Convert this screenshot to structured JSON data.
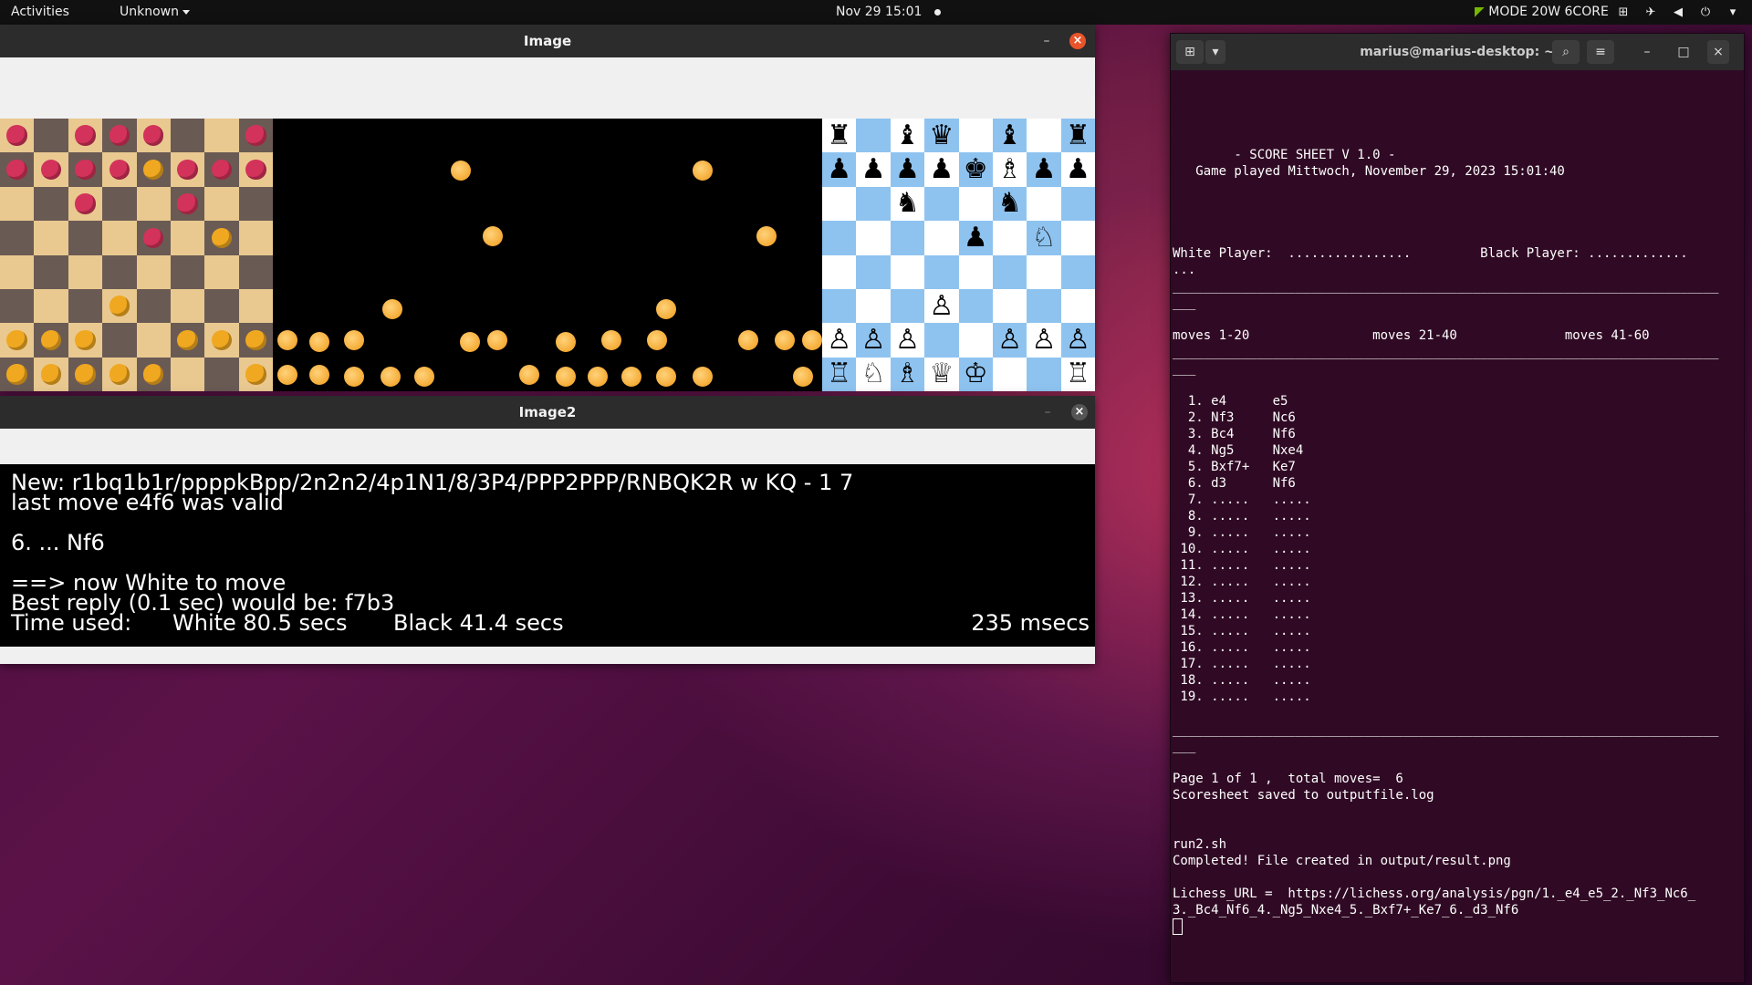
{
  "topbar": {
    "activities": "Activities",
    "app_menu": "Unknown",
    "datetime": "Nov 29  15:01",
    "gpu_mode": "MODE 20W 6CORE"
  },
  "image_window": {
    "title": "Image"
  },
  "image2_window": {
    "title": "Image2",
    "fen_line": "New: r1bq1b1r/ppppkBpp/2n2n2/4p1N1/8/3P4/PPP2PPP/RNBQK2R w KQ - 1 7",
    "valid_line": "last move e4f6 was valid",
    "move_line": "6. ... Nf6",
    "to_move_line": "==> now White to move",
    "best_reply_line": "Best reply (0.1 sec) would be: f7b3",
    "time_label": "Time used:",
    "white_time": "White 80.5 secs",
    "black_time": "Black 41.4 secs",
    "msecs": "235 msecs"
  },
  "diagram": {
    "rows": [
      [
        "♜",
        "",
        "♝",
        "♛",
        "",
        "♝",
        "",
        "♜"
      ],
      [
        "♟",
        "♟",
        "♟",
        "♟",
        "♚",
        "♗",
        "♟",
        "♟"
      ],
      [
        "",
        "",
        "♞",
        "",
        "",
        "♞",
        "",
        ""
      ],
      [
        "",
        "",
        "",
        "",
        "♟",
        "",
        "♘",
        ""
      ],
      [
        "",
        "",
        "",
        "",
        "",
        "",
        "",
        ""
      ],
      [
        "",
        "",
        "",
        "♙",
        "",
        "",
        "",
        ""
      ],
      [
        "♙",
        "♙",
        "♙",
        "",
        "",
        "♙",
        "♙",
        "♙"
      ],
      [
        "♖",
        "♘",
        "♗",
        "♕",
        "♔",
        "",
        "",
        "♖"
      ]
    ]
  },
  "terminal": {
    "title": "marius@marius-desktop: ~",
    "lines": [
      "",
      "",
      "",
      "",
      "        - SCORE SHEET V 1.0 -",
      "   Game played Mittwoch, November 29, 2023 15:01:40",
      "",
      "",
      "",
      "",
      "White Player:  ................         Black Player: .............",
      "...",
      "_______________________________________________________________________",
      "___",
      "",
      "moves 1-20                moves 21-40              moves 41-60",
      "_______________________________________________________________________",
      "___",
      "",
      "  1. e4      e5",
      "  2. Nf3     Nc6",
      "  3. Bc4     Nf6",
      "  4. Ng5     Nxe4",
      "  5. Bxf7+   Ke7",
      "  6. d3      Nf6",
      "  7. .....   .....",
      "  8. .....   .....",
      "  9. .....   .....",
      " 10. .....   .....",
      " 11. .....   .....",
      " 12. .....   .....",
      " 13. .....   .....",
      " 14. .....   .....",
      " 15. .....   .....",
      " 16. .....   .....",
      " 17. .....   .....",
      " 18. .....   .....",
      " 19. .....   .....",
      "",
      "_______________________________________________________________________",
      "___",
      "",
      "Page 1 of 1 ,  total moves=  6",
      "Scoresheet saved to outputfile.log",
      "",
      "",
      "run2.sh",
      "Completed! File created in output/result.png",
      "",
      "Lichess_URL =  https://lichess.org/analysis/pgn/1._e4_e5_2._Nf3_Nc6_",
      "3._Bc4_Nf6_4._Ng5_Nxe4_5._Bxf7+_Ke7_6._d3_Nf6"
    ]
  },
  "colors": {
    "accent_close": "#e9542b",
    "terminal_bg": "#300a24",
    "diagram_dark": "#8ec3f0"
  }
}
